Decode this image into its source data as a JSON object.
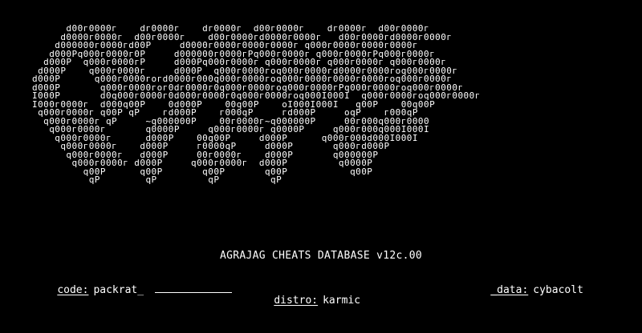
{
  "logo_art": "      d00г0000г    dг0000г    dг0000г  d00г0000г    dг0000г  d00г0000г\n     d0000г0000г  d00г0000г    d00г0000гd0000г0000г   d00г0000гd0000г0000г\n    d000000г0000гd00P     d0000г0000г0000г0000г q000г0000г0000г0000г\n   d000Pq000г0000г0P     d000000г0000гPq000г0000г q000г0000гPq000г0000г\n  d000P  q000г0000гP     d000Pq000г0000г q000г0000г q000г0000г q000г0000г\n d000P    q000г0000г     d000P  q000г0000гoq000г0000гd0000г0000гoq000г0000г\nd000P      q000г0000гoгd0000г000q000г0000гoq000г0000г0000г0000гoq000г0000г\nd000P       q000г0000гoг0dг0000г0q000г0000гoq000г0000гPq000г0000гoq000г0000г\nI000P       d0q000г0000г0d000г0000г0q000г0000гoq000I000I  q000г0000гoq000г0000г\nI000г0000г  d000q00P    0d000P    00q00P    oI000I000I   q00P    00q00P\n q000г0000г q00P qP    гd000P    г000qP     гd000P     oqP    г000qP\n  q000г0000г qP     ~q000000P    00г0000г~q000000P     00г000q000г0000\n   q000г0000г       q0000P     q000г0000г q0000P     q000г000q000I000I\n    q000г0000г      d000P    00q00P     d000P      q000г000d000I000I\n     q000г0000г    d000P     г0000qP     d000P       q000гd000P\n      q000г0000г   d000P     00г0000г    d000P       q000000P\n       q000г0000г d000P     q000г0000г  d000P         q0000P\n         q00P      q00P       q00P       q00P           q00P\n          qP        qP         qP         qP",
  "title": "AGRAJAG CHEATS DATABASE v12c.00",
  "fields": {
    "code": {
      "label": "code:",
      "value": "packrat_"
    },
    "data": {
      "label": "_data:",
      "value": "cybacolt"
    },
    "distro": {
      "label": "distro:",
      "value": "karmic"
    }
  },
  "colors": {
    "background": "#000000",
    "text": "#ffffff"
  }
}
